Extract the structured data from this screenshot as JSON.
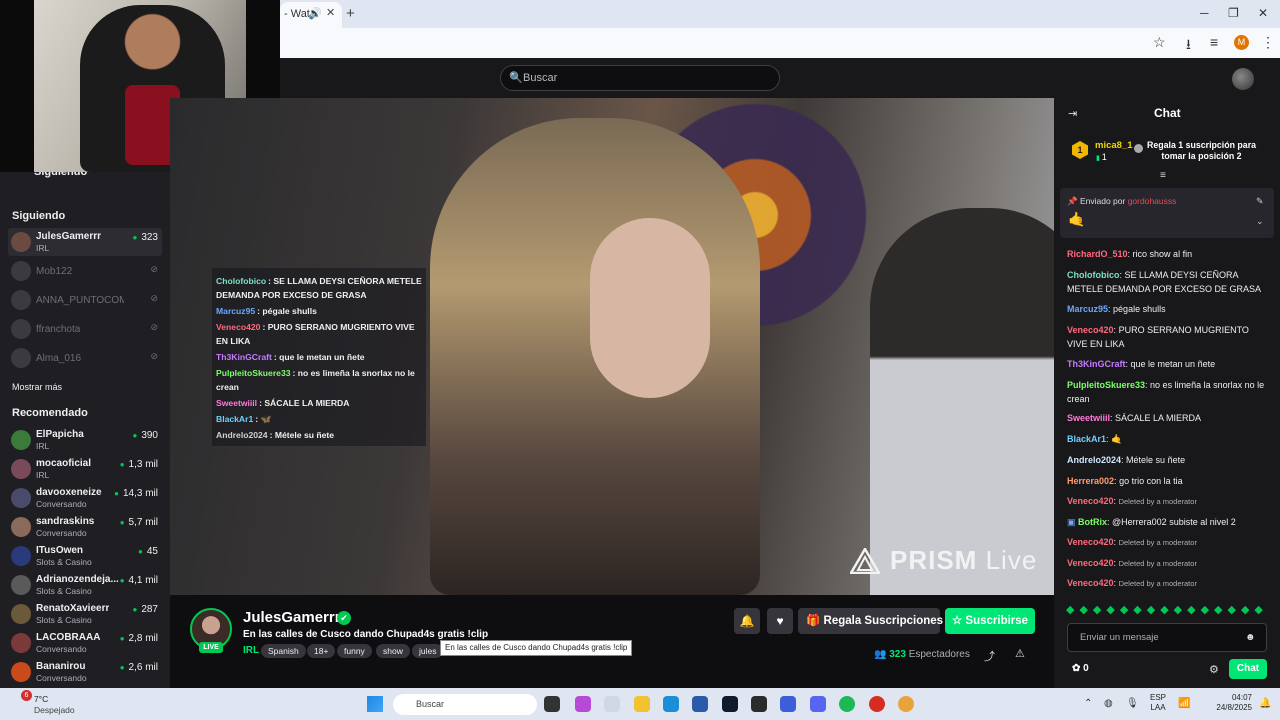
{
  "browser": {
    "tab_title": "- Wat",
    "new_tab": "+",
    "win_minimize": "─",
    "win_restore": "❐",
    "win_close": "✕",
    "profile_initial": "M"
  },
  "topnav": {
    "search_placeholder": "Buscar"
  },
  "sidebar": {
    "collapsed_header": "Siguiendo",
    "following_header": "Siguiendo",
    "following": [
      {
        "name": "JulesGamerrr",
        "category": "IRL",
        "viewers": "323",
        "live": true
      },
      {
        "name": "Mob122",
        "live": false
      },
      {
        "name": "ANNA_PUNTOCOM",
        "live": false
      },
      {
        "name": "ffranchota",
        "live": false
      },
      {
        "name": "Alma_016",
        "live": false
      }
    ],
    "show_more": "Mostrar más",
    "recommended_header": "Recomendado",
    "recommended": [
      {
        "name": "ElPapicha",
        "category": "IRL",
        "viewers": "390"
      },
      {
        "name": "mocaoficial",
        "category": "IRL",
        "viewers": "1,3 mil"
      },
      {
        "name": "davooxeneize",
        "category": "Conversando",
        "viewers": "14,3 mil"
      },
      {
        "name": "sandraskins",
        "category": "Conversando",
        "viewers": "5,7 mil"
      },
      {
        "name": "ITusOwen",
        "category": "Slots & Casino",
        "viewers": "45"
      },
      {
        "name": "Adrianozendeja...",
        "category": "Slots & Casino",
        "viewers": "4,1 mil"
      },
      {
        "name": "RenatoXavieerr",
        "category": "Slots & Casino",
        "viewers": "287"
      },
      {
        "name": "LACOBRAAA",
        "category": "Conversando",
        "viewers": "2,8 mil"
      },
      {
        "name": "Bananirou",
        "category": "Conversando",
        "viewers": "2,6 mil"
      }
    ]
  },
  "video": {
    "watermark_brand": "PRISM",
    "watermark_suffix": "Live",
    "overlay_chat": [
      {
        "user": "Cholofobico",
        "text": "SE LLAMA DEYSI CEÑORA METELE DEMANDA POR EXCESO DE GRASA",
        "color": "#7be0c7"
      },
      {
        "user": "Marcuz95",
        "text": "pégale shulls",
        "color": "#6fa6ff"
      },
      {
        "user": "Veneco420",
        "text": "PURO SERRANO MUGRIENTO VIVE EN LIKA",
        "color": "#ff6a7d"
      },
      {
        "user": "Th3KinGCraft",
        "text": "que le metan un ñete",
        "color": "#c67bff"
      },
      {
        "user": "PulpleitoSkuere33",
        "text": "no es limeña la snorlax no le crean",
        "color": "#7dff6a"
      },
      {
        "user": "Sweetwiiil",
        "text": "SÁCALE LA MIERDA",
        "color": "#ff7ad9"
      },
      {
        "user": "BlackAr1",
        "text": "🦋",
        "color": "#6fd1ff"
      },
      {
        "user": "Andrelo2024",
        "text": "Métele su ñete",
        "color": "#cfcfcf"
      }
    ]
  },
  "stream": {
    "streamer": "JulesGamerrr",
    "live_label": "LIVE",
    "title": "En las calles de Cusco dando Chupad4s gratis !clip",
    "category": "IRL",
    "tags": [
      "Spanish",
      "18+",
      "funny",
      "show",
      "jules"
    ],
    "tooltip": "En las calles de Cusco dando Chupad4s gratis !clip",
    "gift_button": "Regala Suscripciones",
    "subscribe_button": "Suscribirse",
    "viewer_count": "323",
    "viewer_label": "Espectadores"
  },
  "chat": {
    "title": "Chat",
    "leader_rank": "1",
    "leader_user": "mica8_1",
    "leader_count": "1",
    "gift_cta": "Regala 1 suscripción para tomar la posición 2",
    "pinned_label": "Enviado por",
    "pinned_by": "gordohausss",
    "pinned_emote": "🤙",
    "messages": [
      {
        "user": "RichardO_510",
        "text": "rico show al fin",
        "color": "#ff6a7d"
      },
      {
        "user": "Cholofobico",
        "text": "SE LLAMA DEYSI CEÑORA METELE DEMANDA POR EXCESO DE GRASA",
        "color": "#7be0c7"
      },
      {
        "user": "Marcuz95",
        "text": "pégale shulls",
        "color": "#6fa6ff"
      },
      {
        "user": "Veneco420",
        "text": "PURO SERRANO MUGRIENTO VIVE EN LIKA",
        "color": "#ff6a7d"
      },
      {
        "user": "Th3KinGCraft",
        "text": "que le metan un ñete",
        "color": "#c67bff"
      },
      {
        "user": "PulpleitoSkuere33",
        "text": "no es limeña la snorlax no le crean",
        "color": "#7dff6a"
      },
      {
        "user": "Sweetwiiil",
        "text": "SÁCALE LA MIERDA",
        "color": "#ff7ad9"
      },
      {
        "user": "BlackAr1",
        "text": "🤙",
        "color": "#6fd1ff"
      },
      {
        "user": "Andrelo2024",
        "text": "Métele su ñete",
        "color": "#cfe8ff"
      },
      {
        "user": "Herrera002",
        "text": "go trio con la tia",
        "color": "#ff9e6a"
      },
      {
        "user": "Veneco420",
        "text": "Deleted by a moderator",
        "color": "#ff6a7d",
        "deleted": true
      },
      {
        "user": "BotRix",
        "text": "@Herrera002 subiste al nivel 2",
        "color": "#7dff6a"
      },
      {
        "user": "Veneco420",
        "text": "Deleted by a moderator",
        "color": "#ff6a7d",
        "deleted": true
      },
      {
        "user": "Veneco420",
        "text": "Deleted by a moderator",
        "color": "#ff6a7d",
        "deleted": true
      },
      {
        "user": "Veneco420",
        "text": "Deleted by a moderator",
        "color": "#ff6a7d",
        "deleted": true
      }
    ],
    "emote_bar": "◆◆◆◆◆◆◆◆◆◆◆◆◆◆◆",
    "input_placeholder": "Enviar un mensaje",
    "points": "0",
    "send_button": "Chat"
  },
  "taskbar": {
    "weather_badge": "6",
    "temperature": "7°C",
    "condition": "Despejado",
    "search_placeholder": "Buscar",
    "language": "ESP",
    "language_sub": "LAA",
    "time": "04:07",
    "date": "24/8/2025"
  },
  "colors": {
    "accent": "#00e676",
    "background": "#0e0e10",
    "panel": "#18181b",
    "sidebar": "#1f1f23"
  }
}
